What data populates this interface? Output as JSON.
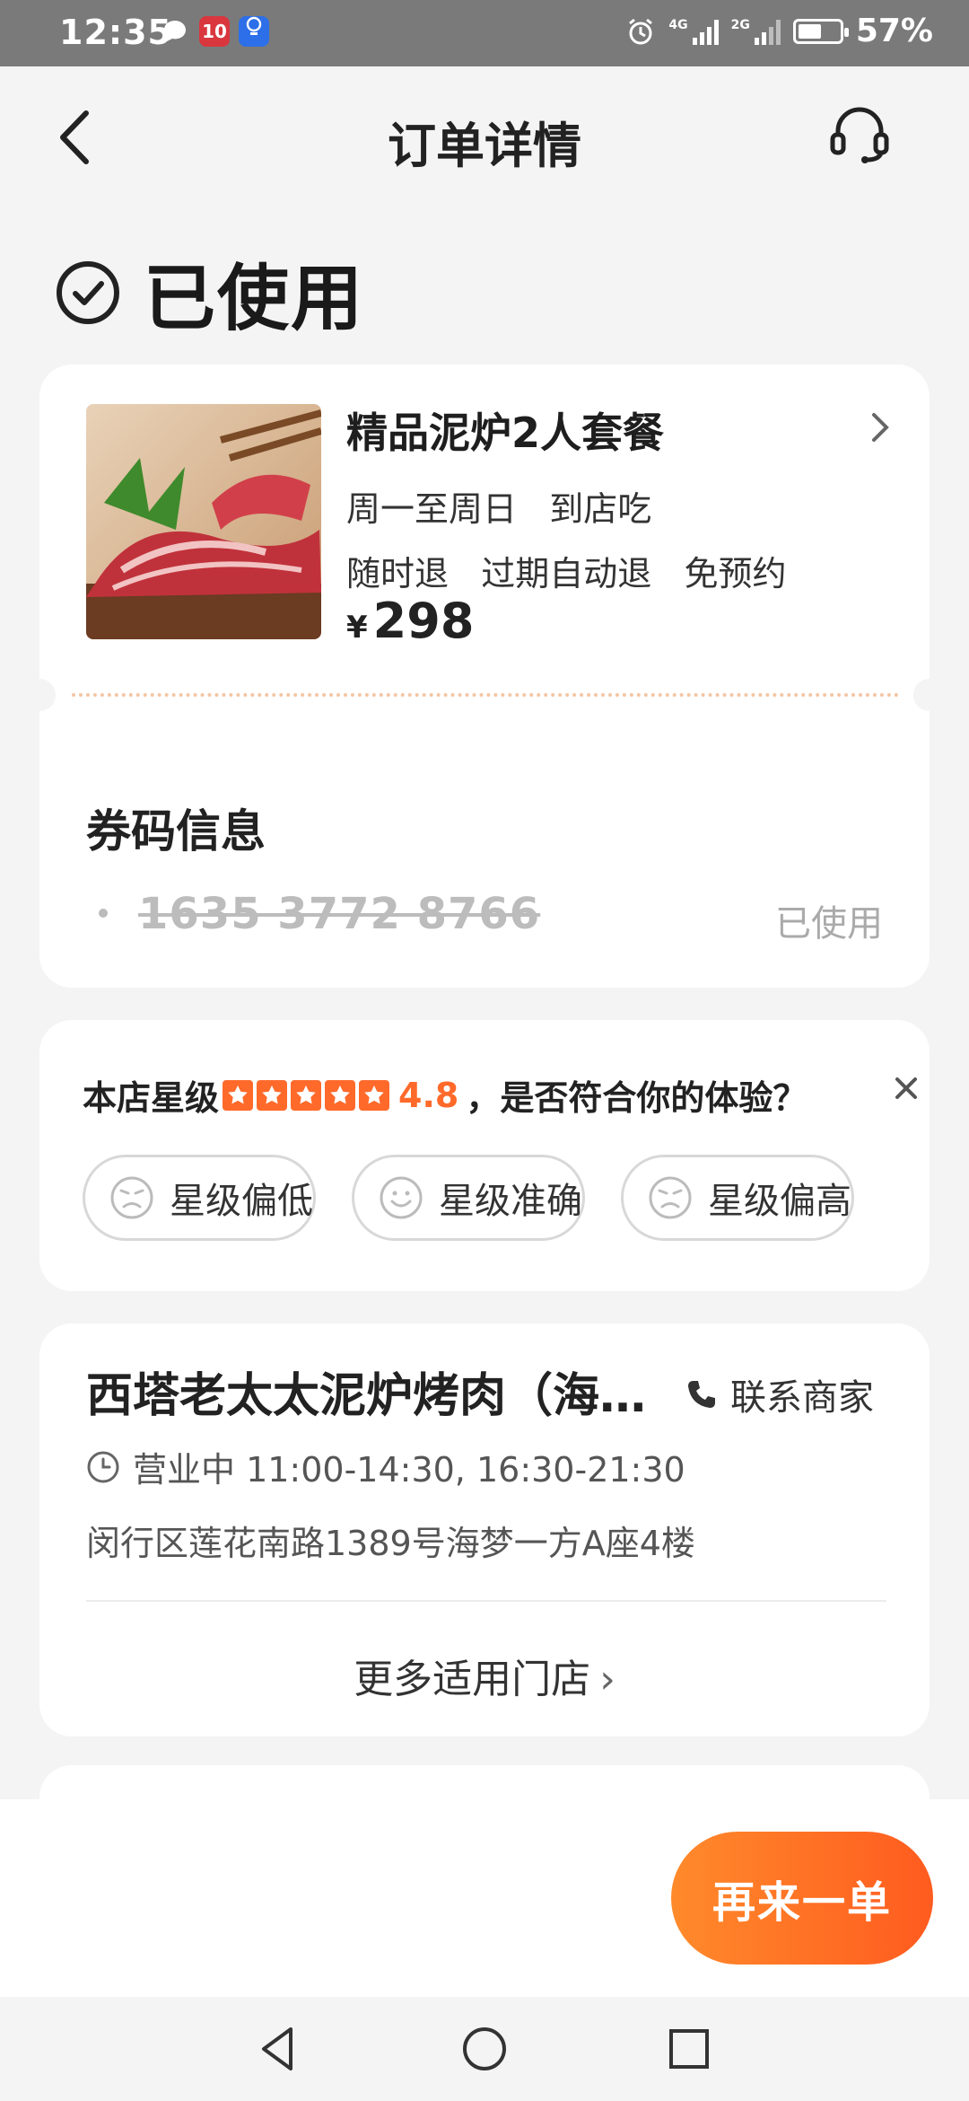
{
  "status_bar": {
    "time": "12:35",
    "battery": "57%",
    "battery_level": 0.57,
    "net1": "4G",
    "net2": "2G",
    "app_chip_label": "10"
  },
  "header": {
    "title": "订单详情"
  },
  "order_status": "已使用",
  "product": {
    "name": "精品泥炉2人套餐",
    "schedule": "周一至周日   到店吃",
    "policies": "随时退   过期自动退   免预约",
    "currency": "¥",
    "price": "298"
  },
  "coupon": {
    "title": "券码信息",
    "code": "1635 3772 8766",
    "status": "已使用"
  },
  "rating": {
    "prefix": "本店星级",
    "score": "4.8",
    "stars": 5,
    "question": "，是否符合你的体验？",
    "options": [
      "星级偏低",
      "星级准确",
      "星级偏高"
    ],
    "accent_color": "#ff6a2b"
  },
  "shop": {
    "name": "西塔老太太泥炉烤肉（海…",
    "contact_label": "联系商家",
    "hours": "营业中 11:00-14:30, 16:30-21:30",
    "address": "闵行区莲花南路1389号海梦一方A座4楼",
    "more_label": "更多适用门店"
  },
  "actions": {
    "reorder_label": "再来一单"
  }
}
